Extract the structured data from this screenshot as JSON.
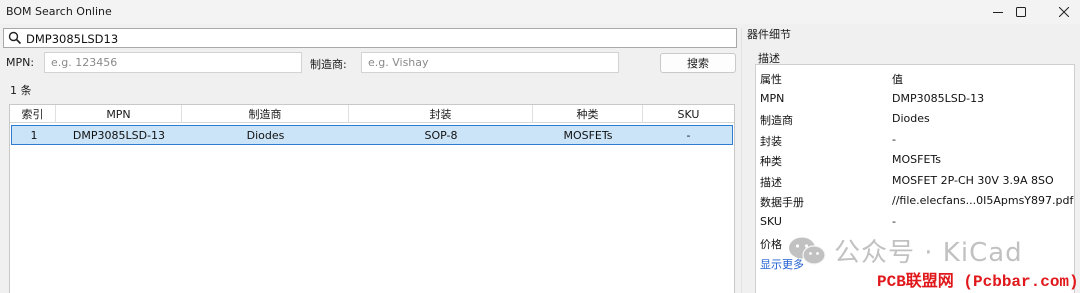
{
  "window": {
    "title": "BOM Search Online",
    "minimize_icon": "minimize-icon",
    "maximize_icon": "maximize-icon",
    "close_icon": "close-icon"
  },
  "search": {
    "icon": "search-icon",
    "value": "DMP3085LSD13"
  },
  "filters": {
    "mpn_label": "MPN:",
    "mpn_placeholder": "e.g. 123456",
    "mfr_label": "制造商:",
    "mfr_placeholder": "e.g. Vishay",
    "search_button": "搜索"
  },
  "results": {
    "count_text": "1 条",
    "columns": [
      "索引",
      "MPN",
      "制造商",
      "封装",
      "种类",
      "SKU"
    ],
    "rows": [
      [
        "1",
        "DMP3085LSD-13",
        "Diodes",
        "SOP-8",
        "MOSFETs",
        "-"
      ]
    ]
  },
  "details": {
    "section_title": "器件细节",
    "group_title": "描述",
    "header": {
      "label": "属性",
      "value": "值"
    },
    "items": [
      {
        "label": "MPN",
        "value": "DMP3085LSD-13"
      },
      {
        "label": "制造商",
        "value": "Diodes"
      },
      {
        "label": "封装",
        "value": "-"
      },
      {
        "label": "种类",
        "value": "MOSFETs"
      },
      {
        "label": "描述",
        "value": "MOSFET 2P-CH 30V 3.9A 8SO"
      },
      {
        "label": "数据手册",
        "value": "//file.elecfans...0I5ApmsY897.pdf"
      },
      {
        "label": "SKU",
        "value": "-"
      },
      {
        "label": "价格",
        "value": ""
      }
    ],
    "more_link": "显示更多"
  },
  "watermark": {
    "text": "公众号 · KiCad",
    "icon": "wechat-icon"
  },
  "site_mark": "PCB联盟网 (Pcbbar.com)"
}
